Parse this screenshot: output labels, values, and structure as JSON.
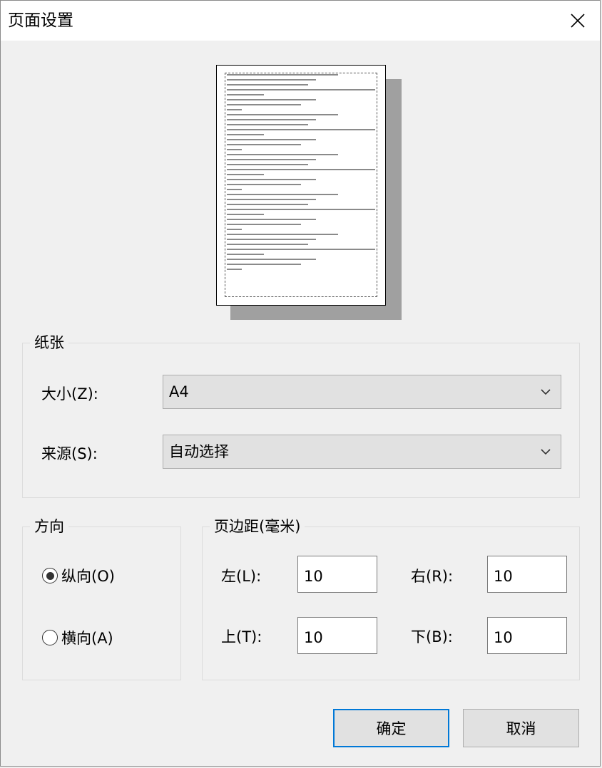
{
  "window": {
    "title": "页面设置"
  },
  "paper": {
    "group_label": "纸张",
    "size_label": "大小(Z):",
    "size_value": "A4",
    "source_label": "来源(S):",
    "source_value": "自动选择"
  },
  "orientation": {
    "group_label": "方向",
    "portrait_label": "纵向(O)",
    "landscape_label": "横向(A)",
    "selected": "portrait"
  },
  "margins": {
    "group_label": "页边距(毫米)",
    "left_label": "左(L):",
    "left_value": "10",
    "right_label": "右(R):",
    "right_value": "10",
    "top_label": "上(T):",
    "top_value": "10",
    "bottom_label": "下(B):",
    "bottom_value": "10"
  },
  "buttons": {
    "ok": "确定",
    "cancel": "取消"
  },
  "colors": {
    "accent": "#0078d7",
    "button_bg": "#e1e1e1",
    "dialog_bg": "#f0f0f0"
  }
}
